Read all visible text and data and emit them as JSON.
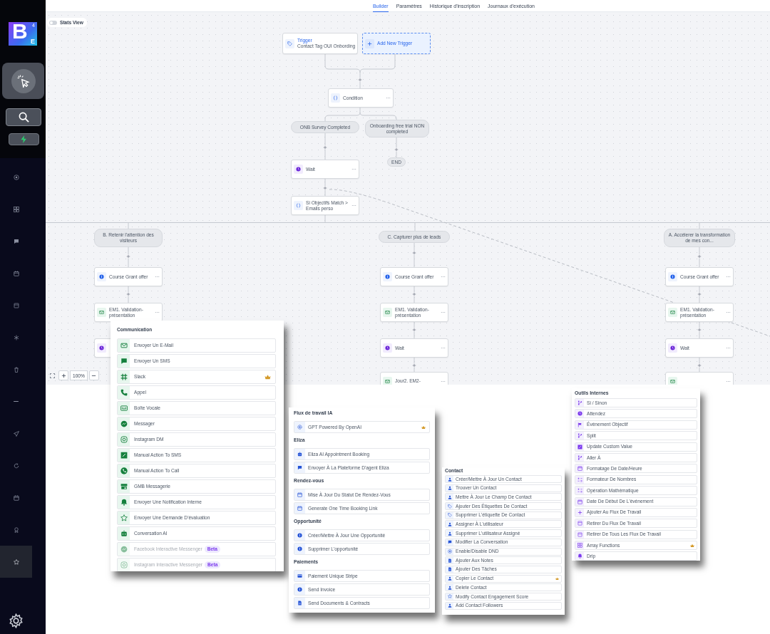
{
  "sidebar": {
    "logo": {
      "letter": "B",
      "superscript": "4",
      "subscript": "E"
    },
    "tools": [
      {
        "selected": true
      },
      {
        "selected": false
      },
      {
        "selected": false
      }
    ],
    "nav_items": [
      {
        "selected": false
      },
      {
        "selected": false
      },
      {
        "selected": false
      },
      {
        "selected": false
      },
      {
        "selected": false
      },
      {
        "selected": false
      },
      {
        "selected": false
      },
      {
        "selected": false
      },
      {
        "selected": false
      },
      {
        "selected": false
      },
      {
        "selected": false
      },
      {
        "selected": false
      },
      {
        "selected": true
      }
    ]
  },
  "tabs": [
    {
      "label": "Builder",
      "selected": true
    },
    {
      "label": "Paramètres",
      "selected": false
    },
    {
      "label": "Historique d'inscription",
      "selected": false
    },
    {
      "label": "Journaux d'exécution",
      "selected": false
    }
  ],
  "stats_view": {
    "label": "Stats View",
    "on": false
  },
  "nodes": [
    {
      "kind": "trigger",
      "title": "Trigger",
      "subtitle": "Contact Tag OUI Onbording"
    },
    {
      "kind": "add_trigger",
      "label": "Add New Trigger"
    },
    {
      "kind": "condition",
      "label": "Condition"
    },
    {
      "kind": "branch",
      "label": "ONB Survey Completed"
    },
    {
      "kind": "branch",
      "label": "Onboarding free trial NON completed"
    },
    {
      "kind": "wait",
      "label": "Wait"
    },
    {
      "kind": "end",
      "label": "END"
    },
    {
      "kind": "condition",
      "label": "Si Objectifs Match > Emails perso"
    },
    {
      "kind": "branch",
      "label": "B. Retenir l'attention des visiteurs"
    },
    {
      "kind": "branch",
      "label": "C. Capturer plus de leads"
    },
    {
      "kind": "branch",
      "label": "A. Accélerer la transformation de mes con..."
    },
    {
      "kind": "offer",
      "label": "Course Grant offer"
    },
    {
      "kind": "offer",
      "label": "Course Grant offer"
    },
    {
      "kind": "offer",
      "label": "Course Grant offer"
    },
    {
      "kind": "email",
      "label": "EM1. Validation-présentation"
    },
    {
      "kind": "email",
      "label": "EM1. Validation-présentation"
    },
    {
      "kind": "email",
      "label": "EM1. Validation-présentation"
    },
    {
      "kind": "wait"
    },
    {
      "kind": "wait",
      "label": "Wait"
    },
    {
      "kind": "wait",
      "label": "Wait"
    },
    {
      "kind": "email",
      "label": "Jour2. EM2-"
    },
    {
      "kind": "email"
    }
  ],
  "zoom": {
    "percent": "100%"
  },
  "panels": [
    {
      "sections": [
        {
          "heading": "Communication",
          "items": [
            {
              "label": "Envoyer Un E-Mail",
              "premium": false,
              "disabled": false
            },
            {
              "label": "Envoyer Un SMS",
              "premium": false,
              "disabled": false
            },
            {
              "label": "Slack",
              "premium": true,
              "disabled": false
            },
            {
              "label": "Appel",
              "premium": false,
              "disabled": false
            },
            {
              "label": "Boîte Vocale",
              "premium": false,
              "disabled": false
            },
            {
              "label": "Messager",
              "premium": false,
              "disabled": false
            },
            {
              "label": "Instagram DM",
              "premium": false,
              "disabled": false
            },
            {
              "label": "Manual Action To SMS",
              "premium": false,
              "disabled": false
            },
            {
              "label": "Manual Action To Call",
              "premium": false,
              "disabled": false
            },
            {
              "label": "GMB Messagerie",
              "premium": false,
              "disabled": false
            },
            {
              "label": "Envoyer Une Notification Interne",
              "premium": false,
              "disabled": false
            },
            {
              "label": "Envoyer Une Demande D'évaluation",
              "premium": false,
              "disabled": false
            },
            {
              "label": "Conversation AI",
              "premium": false,
              "disabled": false
            },
            {
              "label": "Facebook Interactive Messenger",
              "badge": "Beta",
              "premium": false,
              "disabled": true
            },
            {
              "label": "Instagram Interactive Messenger",
              "badge": "Beta",
              "premium": false,
              "disabled": true
            }
          ]
        }
      ]
    },
    {
      "sections": [
        {
          "heading": "Flux de travail IA",
          "items": [
            {
              "label": "GPT Powered By OpenAI",
              "premium": true
            }
          ]
        },
        {
          "heading": "Eliza",
          "items": [
            {
              "label": "Eliza AI Appointment Booking",
              "premium": false
            },
            {
              "label": "Envoyer À La Plateforme D'agent Eliza",
              "premium": false
            }
          ]
        },
        {
          "heading": "Rendez-vous",
          "items": [
            {
              "label": "Mise À Jour Du Statut De Rendez-Vous",
              "premium": false
            },
            {
              "label": "Generate One Time Booking Link",
              "premium": false
            }
          ]
        },
        {
          "heading": "Opportunité",
          "items": [
            {
              "label": "Créer/Mettre À Jour Une Opportunité",
              "premium": false
            },
            {
              "label": "Supprimer L'opportunité",
              "premium": false
            }
          ]
        },
        {
          "heading": "Paiements",
          "items": [
            {
              "label": "Paiement Unique Stripe",
              "premium": false
            },
            {
              "label": "Send Invoice",
              "premium": false
            },
            {
              "label": "Send Documents & Contracts",
              "premium": false
            }
          ]
        }
      ]
    },
    {
      "sections": [
        {
          "heading": "Contact",
          "items": [
            {
              "label": "Créer/Mettre À Jour Un Contact",
              "premium": false
            },
            {
              "label": "Trouver Un Contact",
              "premium": false
            },
            {
              "label": "Mettre À Jour Le Champ De Contact",
              "premium": false
            },
            {
              "label": "Ajouter Des Étiquettes De Contact",
              "premium": false
            },
            {
              "label": "Supprimer L'étiquette De Contact",
              "premium": false
            },
            {
              "label": "Assigner À L'utilisateur",
              "premium": false
            },
            {
              "label": "Supprimer L'utilisateur Assigné",
              "premium": false
            },
            {
              "label": "Modifier La Conversation",
              "premium": false
            },
            {
              "label": "Enable/Disable DND",
              "premium": false
            },
            {
              "label": "Ajouter Aux Notes",
              "premium": false
            },
            {
              "label": "Ajouter Des Tâches",
              "premium": false
            },
            {
              "label": "Copier Le Contact",
              "premium": true
            },
            {
              "label": "Delete Contact",
              "premium": false
            },
            {
              "label": "Modify Contact Engagement Score",
              "premium": false
            },
            {
              "label": "Add Contact Followers",
              "premium": false
            }
          ]
        }
      ]
    },
    {
      "sections": [
        {
          "heading": "Outils Internes",
          "items": [
            {
              "label": "Si / Sinon",
              "premium": false
            },
            {
              "label": "Attendez",
              "premium": false
            },
            {
              "label": "Événement Objectif",
              "premium": false
            },
            {
              "label": "Split",
              "premium": false
            },
            {
              "label": "Update Custom Value",
              "premium": false
            },
            {
              "label": "Aller À",
              "premium": false
            },
            {
              "label": "Formatage De Date/Heure",
              "premium": false
            },
            {
              "label": "Formateur De Nombres",
              "premium": false
            },
            {
              "label": "Opération Mathématique",
              "premium": false
            },
            {
              "label": "Date De Début De L'événement",
              "premium": false
            },
            {
              "label": "Ajouter Au Flux De Travail",
              "premium": false
            },
            {
              "label": "Retirer Du Flux De Travail",
              "premium": false
            },
            {
              "label": "Retirer De Tous Les Flux De Travail",
              "premium": false
            },
            {
              "label": "Array Functions",
              "premium": true
            },
            {
              "label": "Drip",
              "premium": false
            }
          ]
        }
      ]
    }
  ]
}
